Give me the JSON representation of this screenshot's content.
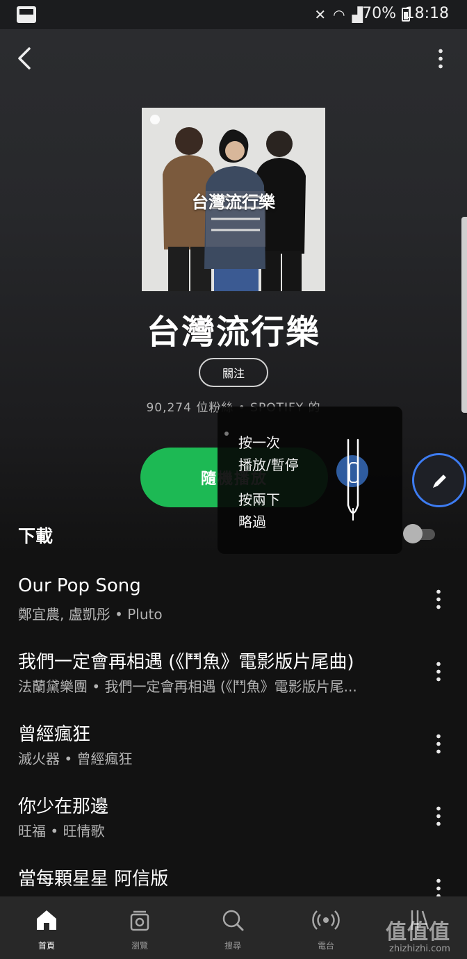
{
  "status_bar": {
    "battery": "70%",
    "time": "18:18",
    "icons": [
      "nfc-icon",
      "mute-icon",
      "wifi-icon",
      "signal-icon",
      "battery-icon"
    ]
  },
  "header": {
    "back_icon": "chevron-left-icon",
    "more_icon": "more-vertical-icon"
  },
  "playlist": {
    "cover_title": "台灣流行樂",
    "title": "台灣流行樂",
    "follow_label": "關注",
    "meta": "90,274 位粉絲 • SPOTIFY 的",
    "shuffle_label": "隨機播放"
  },
  "gesture_overlay": {
    "line1": "按一次",
    "line2": "播放/暫停",
    "line3": "按兩下",
    "line4": "略過"
  },
  "download": {
    "label": "下載",
    "enabled": false
  },
  "tracks": [
    {
      "title": "Our Pop Song",
      "subtitle": "鄭宜農, 盧凱彤 • Pluto"
    },
    {
      "title": "我們一定會再相遇 (《鬥魚》電影版片尾曲)",
      "subtitle": "法蘭黛樂團 • 我們一定會再相遇 (《鬥魚》電影版片尾..."
    },
    {
      "title": "曾經瘋狂",
      "subtitle": "滅火器 • 曾經瘋狂"
    },
    {
      "title": "你少在那邊",
      "subtitle": "旺福 • 旺情歌"
    },
    {
      "title": "當每顆星星 阿信版",
      "subtitle": ""
    }
  ],
  "tabbar": {
    "tabs": [
      {
        "label": "首頁",
        "icon": "home-icon",
        "active": true
      },
      {
        "label": "瀏覽",
        "icon": "browse-icon",
        "active": false
      },
      {
        "label": "搜尋",
        "icon": "search-icon",
        "active": false
      },
      {
        "label": "電台",
        "icon": "radio-icon",
        "active": false
      },
      {
        "label": "",
        "icon": "library-icon",
        "active": false
      }
    ]
  },
  "watermark": {
    "text": "值值值",
    "url": "zhizhizhi.com"
  },
  "colors": {
    "accent_green": "#1db954",
    "focus_blue": "#3d7cf2",
    "background": "#121212",
    "tabbar": "#282828"
  }
}
